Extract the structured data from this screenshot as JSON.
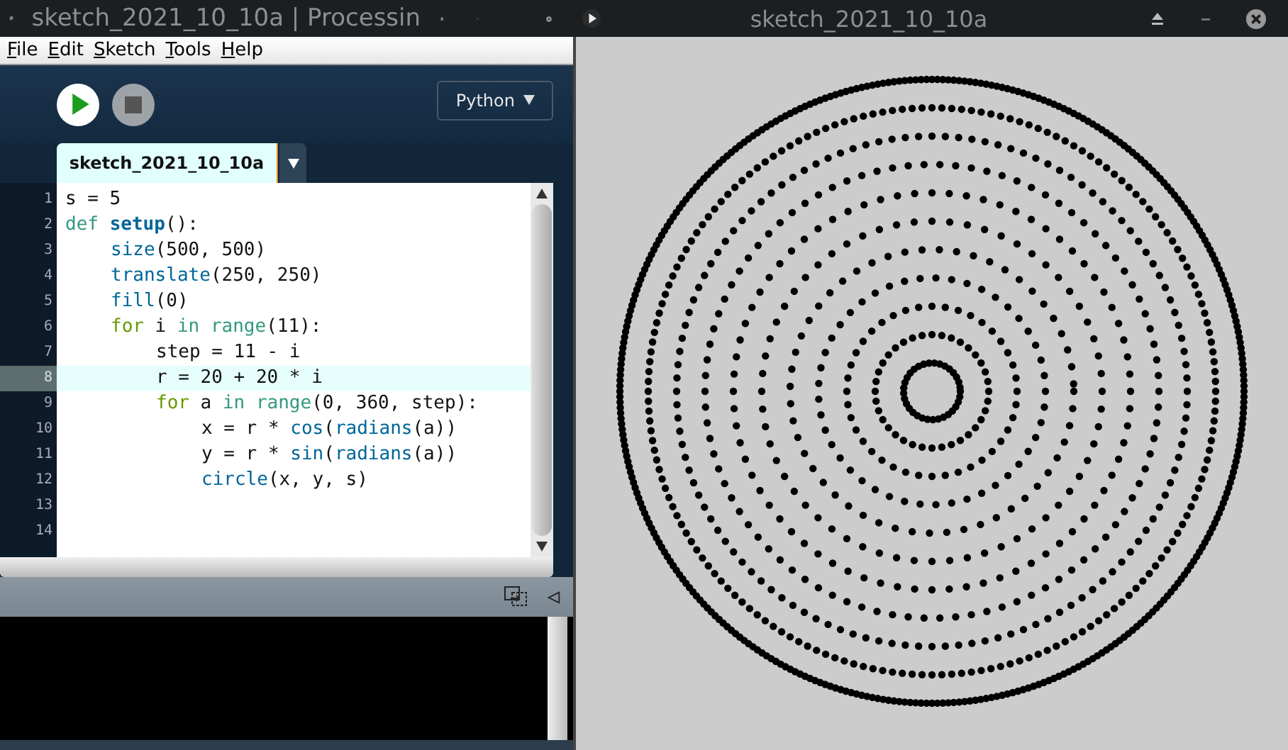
{
  "editor_window": {
    "title": "sketch_2021_10_10a | Processin",
    "menu": [
      "File",
      "Edit",
      "Sketch",
      "Tools",
      "Help"
    ],
    "mode_button": "Python",
    "tab": {
      "label": "sketch_2021_10_10a",
      "selected": true
    },
    "code_lines": [
      {
        "number": "1",
        "selected": false,
        "tokens": [
          {
            "text": "s = 5",
            "kind": "plain"
          }
        ]
      },
      {
        "number": "2",
        "selected": false,
        "tokens": [
          {
            "text": "def ",
            "kind": "builtin"
          },
          {
            "text": "setup",
            "kind": "definition"
          },
          {
            "text": "():",
            "kind": "plain"
          }
        ],
        "children": [
          {
            "number": "3",
            "selected": false,
            "tokens": [
              {
                "text": "size",
                "kind": "function"
              },
              {
                "text": "(500, 500)",
                "kind": "plain"
              }
            ]
          },
          {
            "number": "4",
            "selected": false,
            "tokens": [
              {
                "text": "translate",
                "kind": "function"
              },
              {
                "text": "(250, 250)",
                "kind": "plain"
              }
            ]
          },
          {
            "number": "5",
            "selected": false,
            "tokens": [
              {
                "text": "fill",
                "kind": "function"
              },
              {
                "text": "(0)",
                "kind": "plain"
              }
            ]
          },
          {
            "number": "6",
            "selected": false,
            "tokens": [
              {
                "text": "for",
                "kind": "keyword"
              },
              {
                "text": " i ",
                "kind": "plain"
              },
              {
                "text": "in range",
                "kind": "builtin"
              },
              {
                "text": "(11):",
                "kind": "plain"
              }
            ],
            "children": [
              {
                "number": "7",
                "selected": false,
                "tokens": [
                  {
                    "text": "step = 11 - i",
                    "kind": "plain"
                  }
                ]
              },
              {
                "number": "8",
                "selected": true,
                "tokens": [
                  {
                    "text": "r = 20 + 20 * i",
                    "kind": "plain"
                  }
                ]
              },
              {
                "number": "9",
                "selected": false,
                "tokens": [
                  {
                    "text": "for",
                    "kind": "keyword"
                  },
                  {
                    "text": " a ",
                    "kind": "plain"
                  },
                  {
                    "text": "in range",
                    "kind": "builtin"
                  },
                  {
                    "text": "(0, 360, step):",
                    "kind": "plain"
                  }
                ],
                "children": [
                  {
                    "number": "10",
                    "selected": false,
                    "tokens": [
                      {
                        "text": "x = r * ",
                        "kind": "plain"
                      },
                      {
                        "text": "cos",
                        "kind": "function"
                      },
                      {
                        "text": "(",
                        "kind": "plain"
                      },
                      {
                        "text": "radians",
                        "kind": "function"
                      },
                      {
                        "text": "(a))",
                        "kind": "plain"
                      }
                    ]
                  },
                  {
                    "number": "11",
                    "selected": false,
                    "tokens": [
                      {
                        "text": "y = r * ",
                        "kind": "plain"
                      },
                      {
                        "text": "sin",
                        "kind": "function"
                      },
                      {
                        "text": "(",
                        "kind": "plain"
                      },
                      {
                        "text": "radians",
                        "kind": "function"
                      },
                      {
                        "text": "(a))",
                        "kind": "plain"
                      }
                    ]
                  },
                  {
                    "number": "12",
                    "selected": false,
                    "tokens": [
                      {
                        "text": "circle",
                        "kind": "function"
                      },
                      {
                        "text": "(x, y, s)",
                        "kind": "plain"
                      }
                    ]
                  }
                ]
              }
            ]
          }
        ]
      },
      {
        "number": "13",
        "selected": false
      },
      {
        "number": "14",
        "selected": false
      }
    ]
  },
  "sketch_window": {
    "title": "sketch_2021_10_10a"
  }
}
